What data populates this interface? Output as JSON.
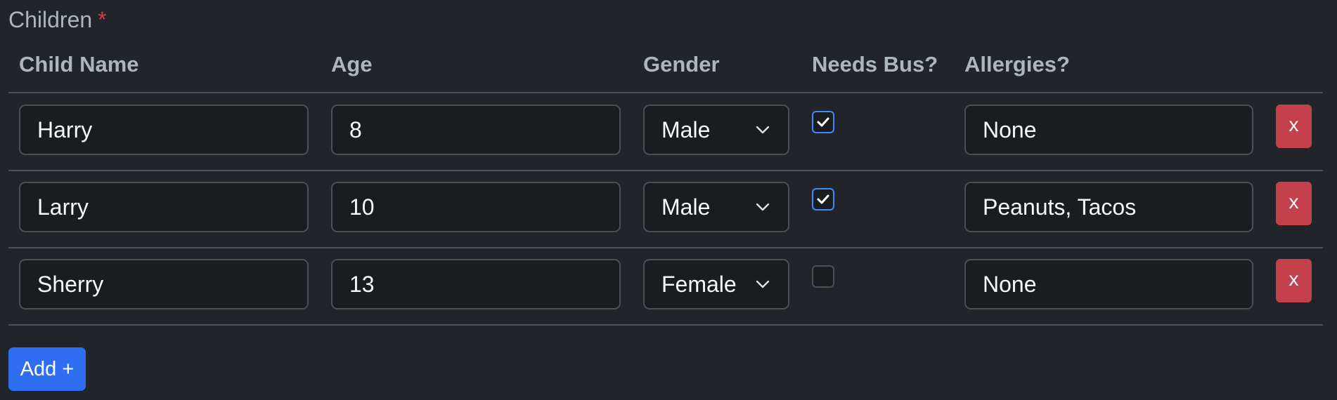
{
  "section": {
    "label": "Children",
    "required_mark": "*"
  },
  "headers": {
    "name": "Child Name",
    "age": "Age",
    "gender": "Gender",
    "bus": "Needs Bus?",
    "allergies": "Allergies?"
  },
  "rows": [
    {
      "name": "Harry",
      "age": "8",
      "gender": "Male",
      "needs_bus": true,
      "allergies": "None",
      "remove_label": "x"
    },
    {
      "name": "Larry",
      "age": "10",
      "gender": "Male",
      "needs_bus": true,
      "allergies": "Peanuts, Tacos",
      "remove_label": "x"
    },
    {
      "name": "Sherry",
      "age": "13",
      "gender": "Female",
      "needs_bus": false,
      "allergies": "None",
      "remove_label": "x"
    }
  ],
  "add_button": {
    "label": "Add +"
  },
  "colors": {
    "background": "#212529",
    "primary": "#2f6ef0",
    "danger": "#c4414b",
    "required": "#dc3545",
    "checkbox_checked_border": "#3d8bfd"
  },
  "icons": {
    "checkbox_check": "check-icon",
    "select_arrow": "chevron-down-icon"
  }
}
